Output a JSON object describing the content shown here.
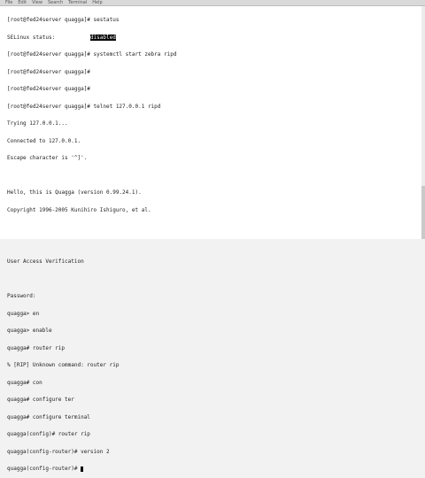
{
  "menu": [
    "File",
    "Edit",
    "View",
    "Search",
    "Terminal",
    "Help"
  ],
  "lines": [
    "[root@fed24server quagga]# sestatus",
    "SELinux status:",
    "[root@fed24server quagga]# systemctl start zebra ripd",
    "[root@fed24server quagga]#",
    "[root@fed24server quagga]#",
    "[root@fed24server quagga]# telnet 127.0.0.1 ripd",
    "Trying 127.0.0.1...",
    "Connected to 127.0.0.1.",
    "Escape character is '^]'.",
    "",
    "Hello, this is Quagga (version 0.99.24.1).",
    "Copyright 1996-2005 Kunihiro Ishiguro, et al.",
    "",
    "",
    "User Access Verification",
    "",
    "Password:",
    "quagga> en",
    "quagga> enable",
    "quagga# router rip",
    "% [RIP] Unknown command: router rip",
    "quagga# con",
    "quagga# configure ter",
    "quagga# configure terminal",
    "quagga(config)# router rip",
    "quagga(config-router)# version 2",
    "quagga(config-router)# "
  ],
  "selinux_value": "disabled",
  "selinux_pad": "           "
}
